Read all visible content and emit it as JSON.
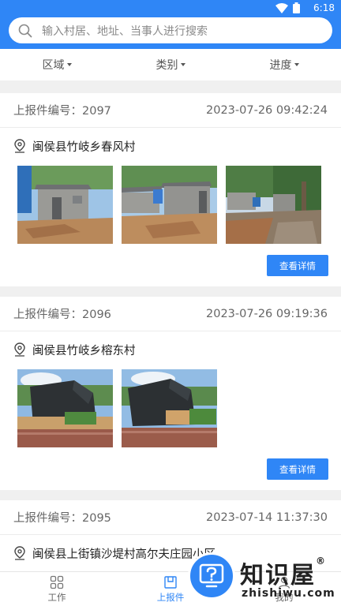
{
  "status_bar": {
    "time": "6:18"
  },
  "search": {
    "placeholder": "输入村居、地址、当事人进行搜索"
  },
  "filters": [
    {
      "label": "区域"
    },
    {
      "label": "类别"
    },
    {
      "label": "进度"
    }
  ],
  "reports": [
    {
      "number_label": "上报件编号：2097",
      "datetime": "2023-07-26 09:42:24",
      "location": "闽侯县竹岐乡春风村",
      "detail_label": "查看详情"
    },
    {
      "number_label": "上报件编号：2096",
      "datetime": "2023-07-26 09:19:36",
      "location": "闽侯县竹岐乡榕东村",
      "detail_label": "查看详情"
    },
    {
      "number_label": "上报件编号：2095",
      "datetime": "2023-07-14 11:37:30",
      "location": "闽侯县上街镇沙堤村高尔夫庄园小区"
    }
  ],
  "tabbar": [
    {
      "label": "工作"
    },
    {
      "label": "上报件"
    },
    {
      "label": "我的"
    }
  ],
  "watermark": {
    "title": "知识屋",
    "url": "zhishiwu.com"
  },
  "colors": {
    "primary": "#2f86f6",
    "background": "#f0f0f0"
  }
}
